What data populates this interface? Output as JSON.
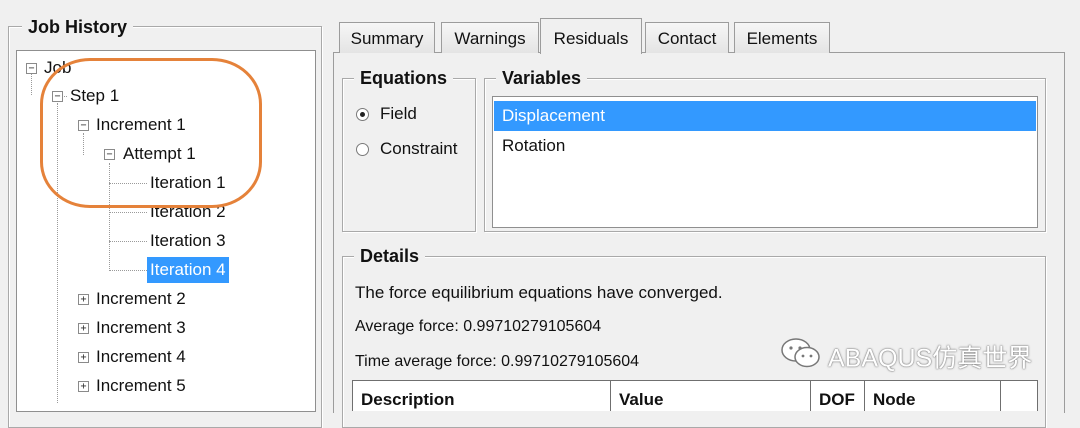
{
  "job_history": {
    "title": "Job History",
    "tree": {
      "job": "Job",
      "step": "Step 1",
      "increment1": "Increment 1",
      "attempt": "Attempt 1",
      "iterations": [
        "Iteration 1",
        "Iteration 2",
        "Iteration 3",
        "Iteration 4"
      ],
      "selected_iteration": "Iteration 4",
      "collapsed_increments": [
        "Increment 2",
        "Increment 3",
        "Increment 4",
        "Increment 5"
      ],
      "toggle_expanded": "−",
      "toggle_collapsed": "+"
    }
  },
  "tabs": [
    "Summary",
    "Warnings",
    "Residuals",
    "Contact",
    "Elements"
  ],
  "active_tab": "Residuals",
  "equations": {
    "title": "Equations",
    "options": [
      "Field",
      "Constraint"
    ],
    "selected": "Field"
  },
  "variables": {
    "title": "Variables",
    "items": [
      "Displacement",
      "Rotation"
    ],
    "selected": "Displacement"
  },
  "details": {
    "title": "Details",
    "message": "The force equilibrium equations have converged.",
    "average_force": "Average force: 0.99710279105604",
    "time_average_force": "Time average force: 0.99710279105604"
  },
  "table": {
    "columns": [
      "Description",
      "Value",
      "DOF",
      "Node"
    ]
  },
  "watermark": {
    "icon": "wechat-icon",
    "text": "ABAQUS仿真世界"
  },
  "colors": {
    "selection": "#3399ff",
    "highlight_ellipse": "#e5823a"
  }
}
